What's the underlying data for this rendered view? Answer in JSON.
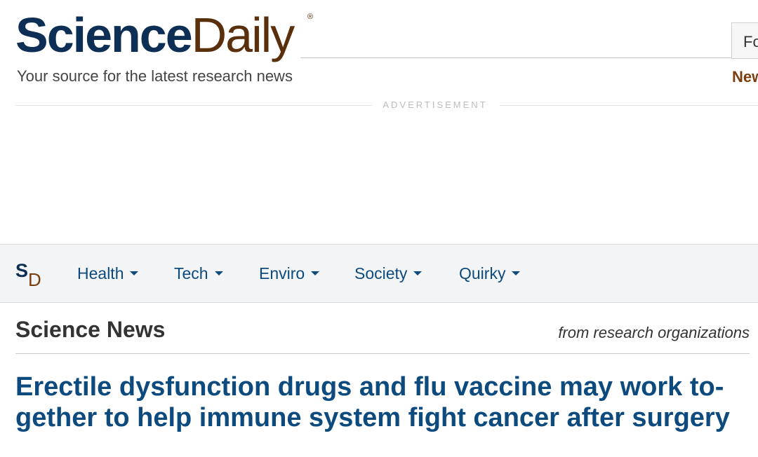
{
  "logo": {
    "science": "Science",
    "daily": "Daily",
    "reg": "®"
  },
  "header": {
    "tagline": "Your source for the latest research news",
    "search_fragment": "Fo",
    "news_fragment": "New"
  },
  "ad": {
    "label": "ADVERTISEMENT"
  },
  "nav": {
    "logo_s": "S",
    "logo_d": "D",
    "items": [
      {
        "label": "Health"
      },
      {
        "label": "Tech"
      },
      {
        "label": "Enviro"
      },
      {
        "label": "Society"
      },
      {
        "label": "Quirky"
      }
    ]
  },
  "section": {
    "title": "Science News",
    "subtitle": "from research organizations"
  },
  "article": {
    "headline": "Erectile dysfunction drugs and flu vaccine may work to­gether to help immune system fight cancer after surgery"
  },
  "colors": {
    "brand_navy": "#0d2f55",
    "brand_brown": "#5a2f0c",
    "link_blue": "#0d4a7e"
  }
}
